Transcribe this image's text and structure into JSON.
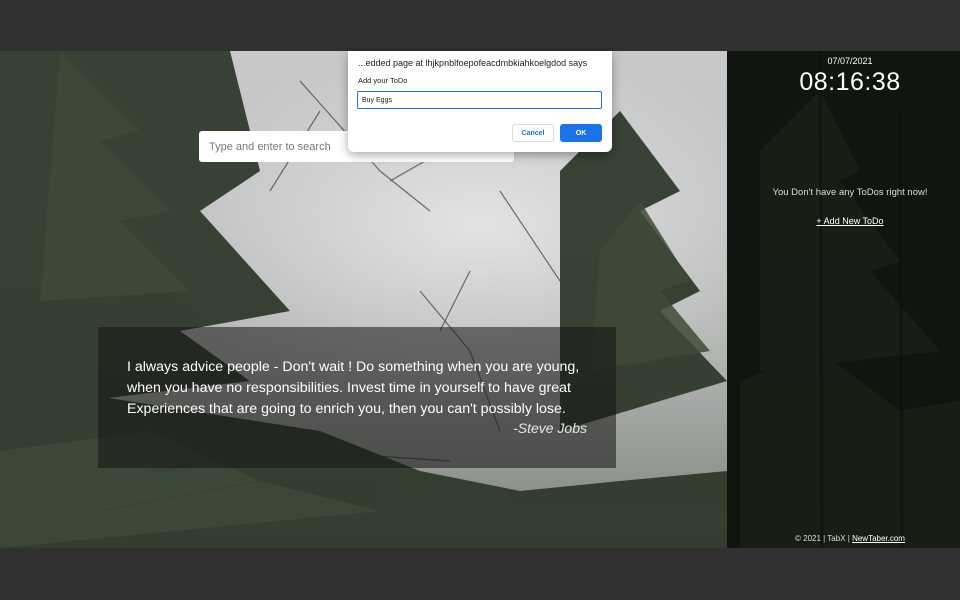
{
  "search": {
    "placeholder": "Type and enter to search"
  },
  "quote": {
    "text": "I always advice people - Don't wait ! Do something when you are young, when you have no responsibilities. Invest time in yourself to have great Experiences that are going to enrich you, then you can't possibly lose.",
    "author": "-Steve Jobs"
  },
  "clock": {
    "date": "07/07/2021",
    "time": "08:16:38"
  },
  "todos": {
    "empty_message": "You Don't have any ToDos right now!",
    "add_label": "+ Add New ToDo"
  },
  "footer": {
    "copyright": "© 2021 | TabX | ",
    "link": "NewTaber.com"
  },
  "dialog": {
    "title": "...edded page at lhjkpnblfoepofeacdmbkiahkoelgdod says",
    "prompt": "Add your ToDo",
    "input_value": "Buy Eggs",
    "cancel_label": "Cancel",
    "ok_label": "OK"
  },
  "colors": {
    "accent": "#1a73e8",
    "outer_bg": "#303030"
  }
}
